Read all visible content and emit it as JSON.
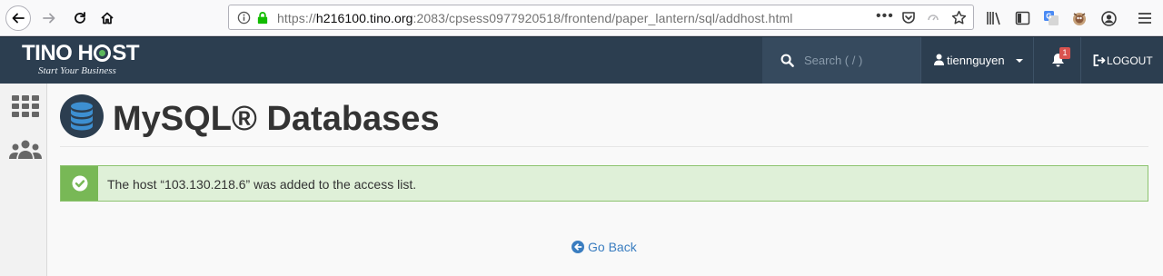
{
  "browser": {
    "url_scheme": "https://",
    "url_host": "h216100.tino.org",
    "url_rest": ":2083/cpsess0977920518/frontend/paper_lantern/sql/addhost.html",
    "more_label": "•••"
  },
  "header": {
    "logo_part1": "TINO H",
    "logo_part2": "ST",
    "logo_tagline": "Start Your Business",
    "search_placeholder": "Search ( / )",
    "username": "tiennguyen",
    "notification_count": "1",
    "logout_label": "LOGOUT"
  },
  "page": {
    "title": "MySQL® Databases",
    "alert_message": "The host “103.130.218.6” was added to the access list.",
    "go_back_label": "Go Back"
  },
  "colors": {
    "header_bg": "#2c3e50",
    "alert_bg": "#dff0d8",
    "alert_accent": "#78b856",
    "link": "#3a7dc0",
    "badge": "#d9534f"
  }
}
